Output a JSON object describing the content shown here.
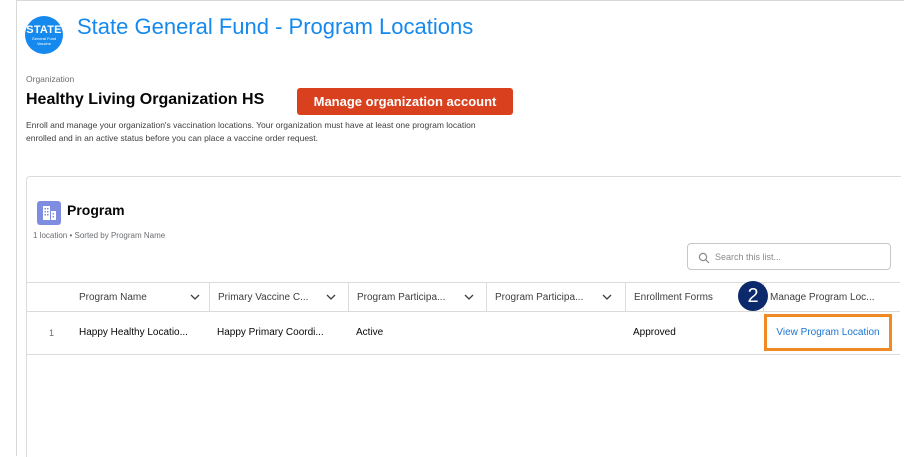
{
  "header": {
    "logo_big": "STATE",
    "logo_small": "General Fund Vaccine",
    "title": "State General Fund - Program Locations"
  },
  "organization": {
    "label": "Organization",
    "name": "Healthy Living Organization HS",
    "manage_button": "Manage organization account",
    "description": "Enroll and manage your organization's vaccination locations. Your organization must have at least one program location enrolled and in an active status before you can place a vaccine order request."
  },
  "program": {
    "title": "Program",
    "subtitle": "1 location • Sorted by Program Name",
    "search_placeholder": "Search this list...",
    "columns": [
      "Program Name",
      "Primary Vaccine C...",
      "Program Participa...",
      "Program Participa...",
      "Enrollment Forms",
      "Manage Program Loc..."
    ],
    "rows": [
      {
        "num": "1",
        "program_name": "Happy Healthy Locatio...",
        "primary_contact": "Happy Primary Coordi...",
        "participation_status": "Active",
        "participation_2": "",
        "enrollment_forms": "Approved",
        "manage_link": "View Program Location"
      }
    ]
  },
  "callout": {
    "step": "2"
  },
  "colors": {
    "accent": "#1589ee",
    "manage_button": "#d9411e",
    "highlight": "#f08a24",
    "badge": "#0c2a6b",
    "link": "#1b76d3"
  }
}
